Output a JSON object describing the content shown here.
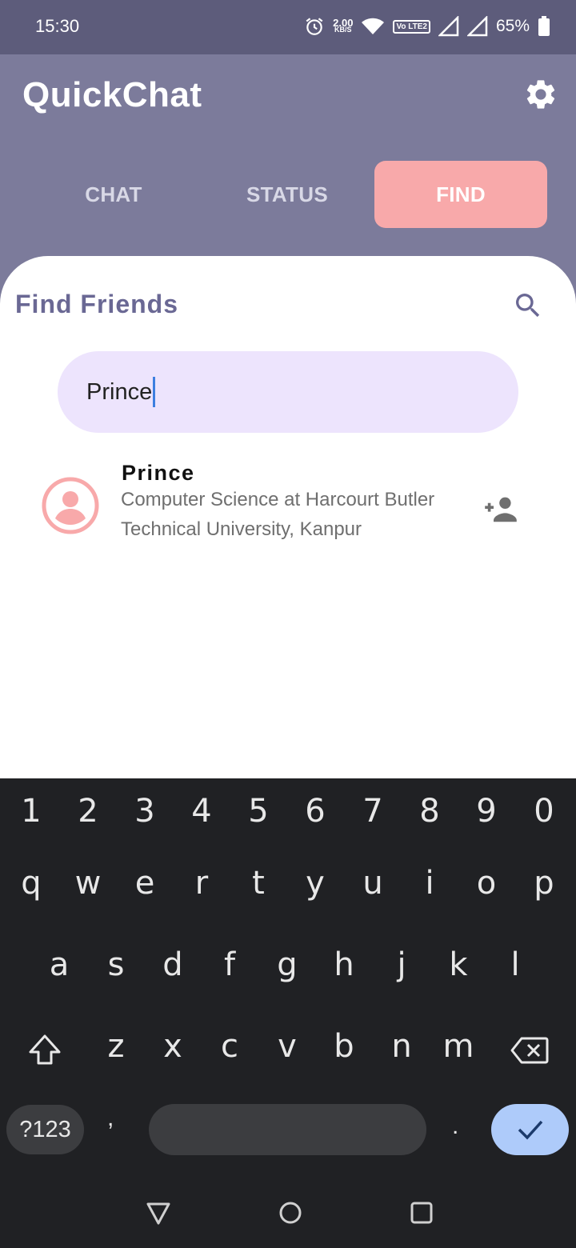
{
  "status_bar": {
    "time": "15:30",
    "net_speed_value": "2.00",
    "net_speed_unit": "KB/S",
    "volte_label": "Vo LTE2",
    "battery_percent": "65%"
  },
  "header": {
    "app_title": "QuickChat",
    "settings_icon": "gear-icon",
    "tabs": [
      {
        "label": "CHAT",
        "active": false
      },
      {
        "label": "STATUS",
        "active": false
      },
      {
        "label": "FIND",
        "active": true
      }
    ]
  },
  "find": {
    "heading": "Find Friends",
    "search_icon": "search-icon",
    "search_value": "Prince",
    "results": [
      {
        "name": "Prince",
        "description": "Computer Science at Harcourt Butler Technical University, Kanpur",
        "avatar_icon": "account-circle-icon",
        "action_icon": "person-add-icon"
      }
    ]
  },
  "keyboard": {
    "number_row": [
      "1",
      "2",
      "3",
      "4",
      "5",
      "6",
      "7",
      "8",
      "9",
      "0"
    ],
    "row1": [
      "q",
      "w",
      "e",
      "r",
      "t",
      "y",
      "u",
      "i",
      "o",
      "p"
    ],
    "row2": [
      "a",
      "s",
      "d",
      "f",
      "g",
      "h",
      "j",
      "k",
      "l"
    ],
    "row3": [
      "z",
      "x",
      "c",
      "v",
      "b",
      "n",
      "m"
    ],
    "symbols_label": "?123",
    "comma": ",",
    "period": "."
  },
  "colors": {
    "header_bg": "#7c7b9b",
    "status_bg": "#5d5c7b",
    "active_tab": "#f8a9aa",
    "search_field_bg": "#ede4fd",
    "heading_text": "#6a6894",
    "keyboard_bg": "#202124",
    "done_key": "#aecbfa"
  }
}
